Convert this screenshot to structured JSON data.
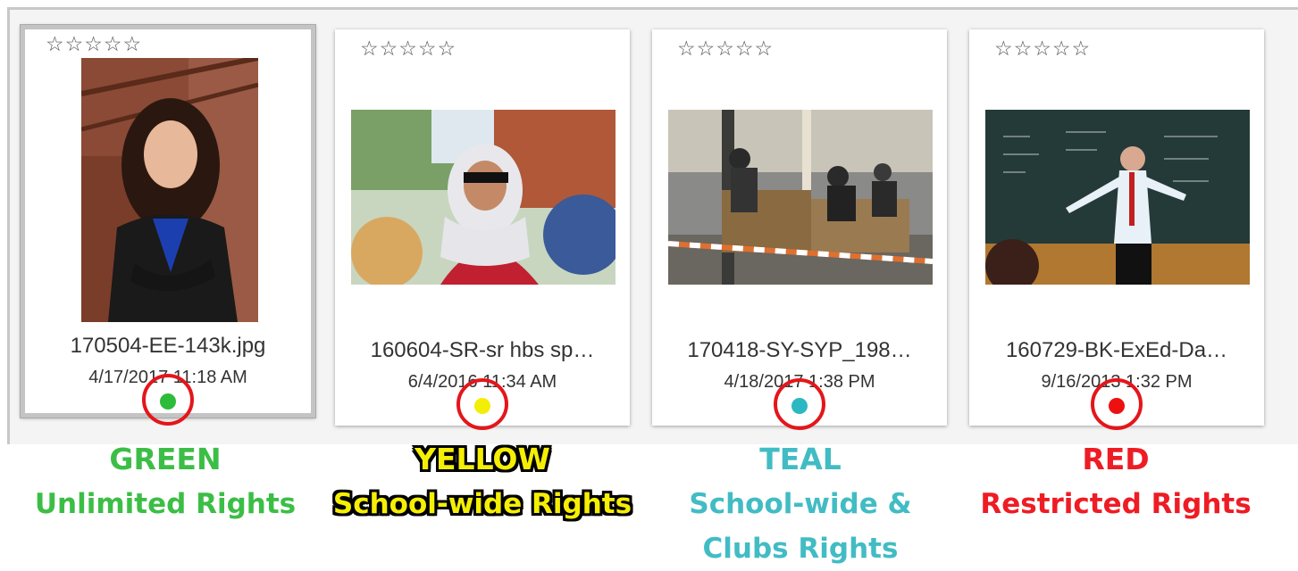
{
  "cards": [
    {
      "stars": "☆☆☆☆☆",
      "filename": "170504-EE-143k.jpg",
      "date": "4/17/2017 11:18 AM",
      "dot_color": "#2dbb3a",
      "selected": true
    },
    {
      "stars": "☆☆☆☆☆",
      "filename": "160604-SR-sr hbs sp…",
      "date": "6/4/2016 11:34 AM",
      "dot_color": "#f3ee05",
      "selected": false
    },
    {
      "stars": "☆☆☆☆☆",
      "filename": "170418-SY-SYP_198…",
      "date": "4/18/2017 1:38 PM",
      "dot_color": "#2bb8c2",
      "selected": false
    },
    {
      "stars": "☆☆☆☆☆",
      "filename": "160729-BK-ExEd-Da…",
      "date": "9/16/2013 1:32 PM",
      "dot_color": "#ee1010",
      "selected": false
    }
  ],
  "legend": [
    {
      "title": "GREEN",
      "subtitle": "Unlimited Rights",
      "color": "#3cbe46"
    },
    {
      "title": "YELLOW",
      "subtitle": "School-wide Rights",
      "color": "#f5ee05"
    },
    {
      "title": "TEAL",
      "subtitle": "School-wide & Clubs Rights",
      "color": "#42bcc4"
    },
    {
      "title": "RED",
      "subtitle": "Restricted Rights",
      "color": "#ee1c24"
    }
  ],
  "colors": {
    "highlight_ring": "#e4161b"
  }
}
